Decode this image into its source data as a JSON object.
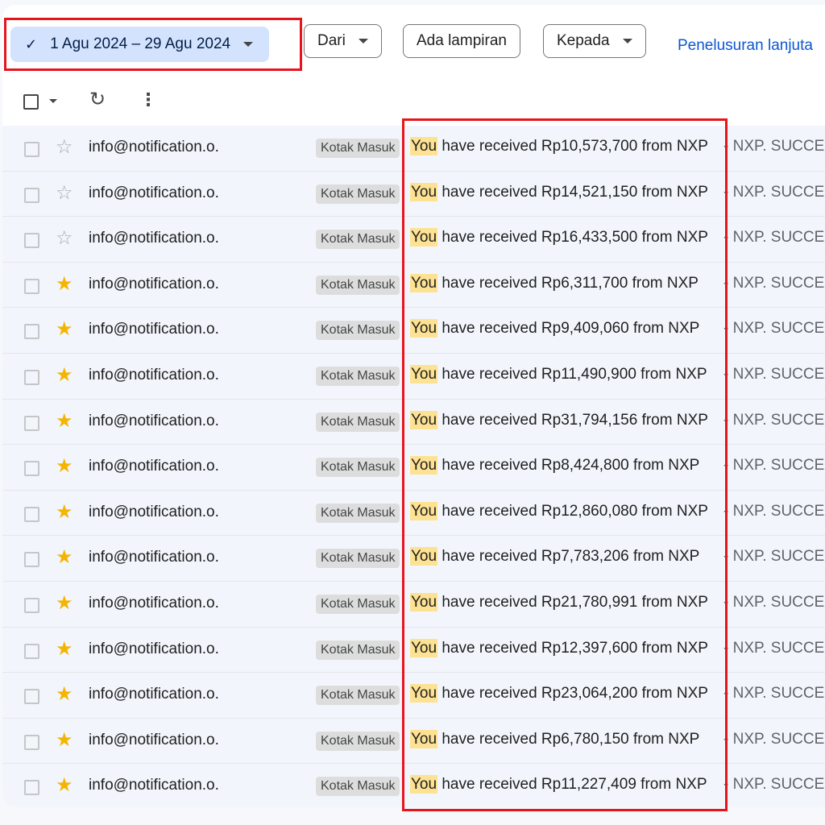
{
  "chips": {
    "date_range": "1 Agu 2024 – 29 Agu 2024",
    "from": "Dari",
    "has_attachment": "Ada lampiran",
    "to": "Kepada",
    "advanced_search": "Penelusuran lanjuta"
  },
  "icons": {
    "check": "check-icon",
    "refresh": "refresh-icon",
    "more": "more-vert-icon",
    "star_empty": "star-outline-icon",
    "star_filled": "star-filled-icon"
  },
  "colors": {
    "active_chip": "#d3e3fd",
    "search_highlight": "#fde293",
    "annotation_red": "#e8141c",
    "star": "#f4b400",
    "link": "#0b57d0"
  },
  "emails": [
    {
      "sender": "info@notification.o.",
      "label": "Kotak Masuk",
      "subject_highlight": "You",
      "subject_rest": " have received Rp10,573,700 from NXP",
      "snippet": "- NXP. SUCCESS",
      "starred": false
    },
    {
      "sender": "info@notification.o.",
      "label": "Kotak Masuk",
      "subject_highlight": "You",
      "subject_rest": " have received Rp14,521,150 from NXP",
      "snippet": "- NXP. SUCCESS",
      "starred": false
    },
    {
      "sender": "info@notification.o.",
      "label": "Kotak Masuk",
      "subject_highlight": "You",
      "subject_rest": " have received Rp16,433,500 from NXP",
      "snippet": "- NXP. SUCCESS",
      "starred": false
    },
    {
      "sender": "info@notification.o.",
      "label": "Kotak Masuk",
      "subject_highlight": "You",
      "subject_rest": " have received Rp6,311,700 from NXP",
      "snippet": "- NXP. SUCCESS",
      "starred": true
    },
    {
      "sender": "info@notification.o.",
      "label": "Kotak Masuk",
      "subject_highlight": "You",
      "subject_rest": " have received Rp9,409,060 from NXP",
      "snippet": "- NXP. SUCCESS",
      "starred": true
    },
    {
      "sender": "info@notification.o.",
      "label": "Kotak Masuk",
      "subject_highlight": "You",
      "subject_rest": " have received Rp11,490,900 from NXP",
      "snippet": "- NXP. SUCCESS",
      "starred": true
    },
    {
      "sender": "info@notification.o.",
      "label": "Kotak Masuk",
      "subject_highlight": "You",
      "subject_rest": " have received Rp31,794,156 from NXP",
      "snippet": "- NXP. SUCCESS",
      "starred": true
    },
    {
      "sender": "info@notification.o.",
      "label": "Kotak Masuk",
      "subject_highlight": "You",
      "subject_rest": " have received Rp8,424,800 from NXP",
      "snippet": "- NXP. SUCCESS",
      "starred": true
    },
    {
      "sender": "info@notification.o.",
      "label": "Kotak Masuk",
      "subject_highlight": "You",
      "subject_rest": " have received Rp12,860,080 from NXP",
      "snippet": "- NXP. SUCCESS",
      "starred": true
    },
    {
      "sender": "info@notification.o.",
      "label": "Kotak Masuk",
      "subject_highlight": "You",
      "subject_rest": " have received Rp7,783,206 from NXP",
      "snippet": "- NXP. SUCCESS",
      "starred": true
    },
    {
      "sender": "info@notification.o.",
      "label": "Kotak Masuk",
      "subject_highlight": "You",
      "subject_rest": " have received Rp21,780,991 from NXP",
      "snippet": "- NXP. SUCCESS",
      "starred": true
    },
    {
      "sender": "info@notification.o.",
      "label": "Kotak Masuk",
      "subject_highlight": "You",
      "subject_rest": " have received Rp12,397,600 from NXP",
      "snippet": "- NXP. SUCCESS",
      "starred": true
    },
    {
      "sender": "info@notification.o.",
      "label": "Kotak Masuk",
      "subject_highlight": "You",
      "subject_rest": " have received Rp23,064,200 from NXP",
      "snippet": "- NXP. SUCCESS",
      "starred": true
    },
    {
      "sender": "info@notification.o.",
      "label": "Kotak Masuk",
      "subject_highlight": "You",
      "subject_rest": " have received Rp6,780,150 from NXP",
      "snippet": "- NXP. SUCCESS",
      "starred": true
    },
    {
      "sender": "info@notification.o.",
      "label": "Kotak Masuk",
      "subject_highlight": "You",
      "subject_rest": " have received Rp11,227,409 from NXP",
      "snippet": "- NXP. SUCCESS",
      "starred": true
    }
  ]
}
